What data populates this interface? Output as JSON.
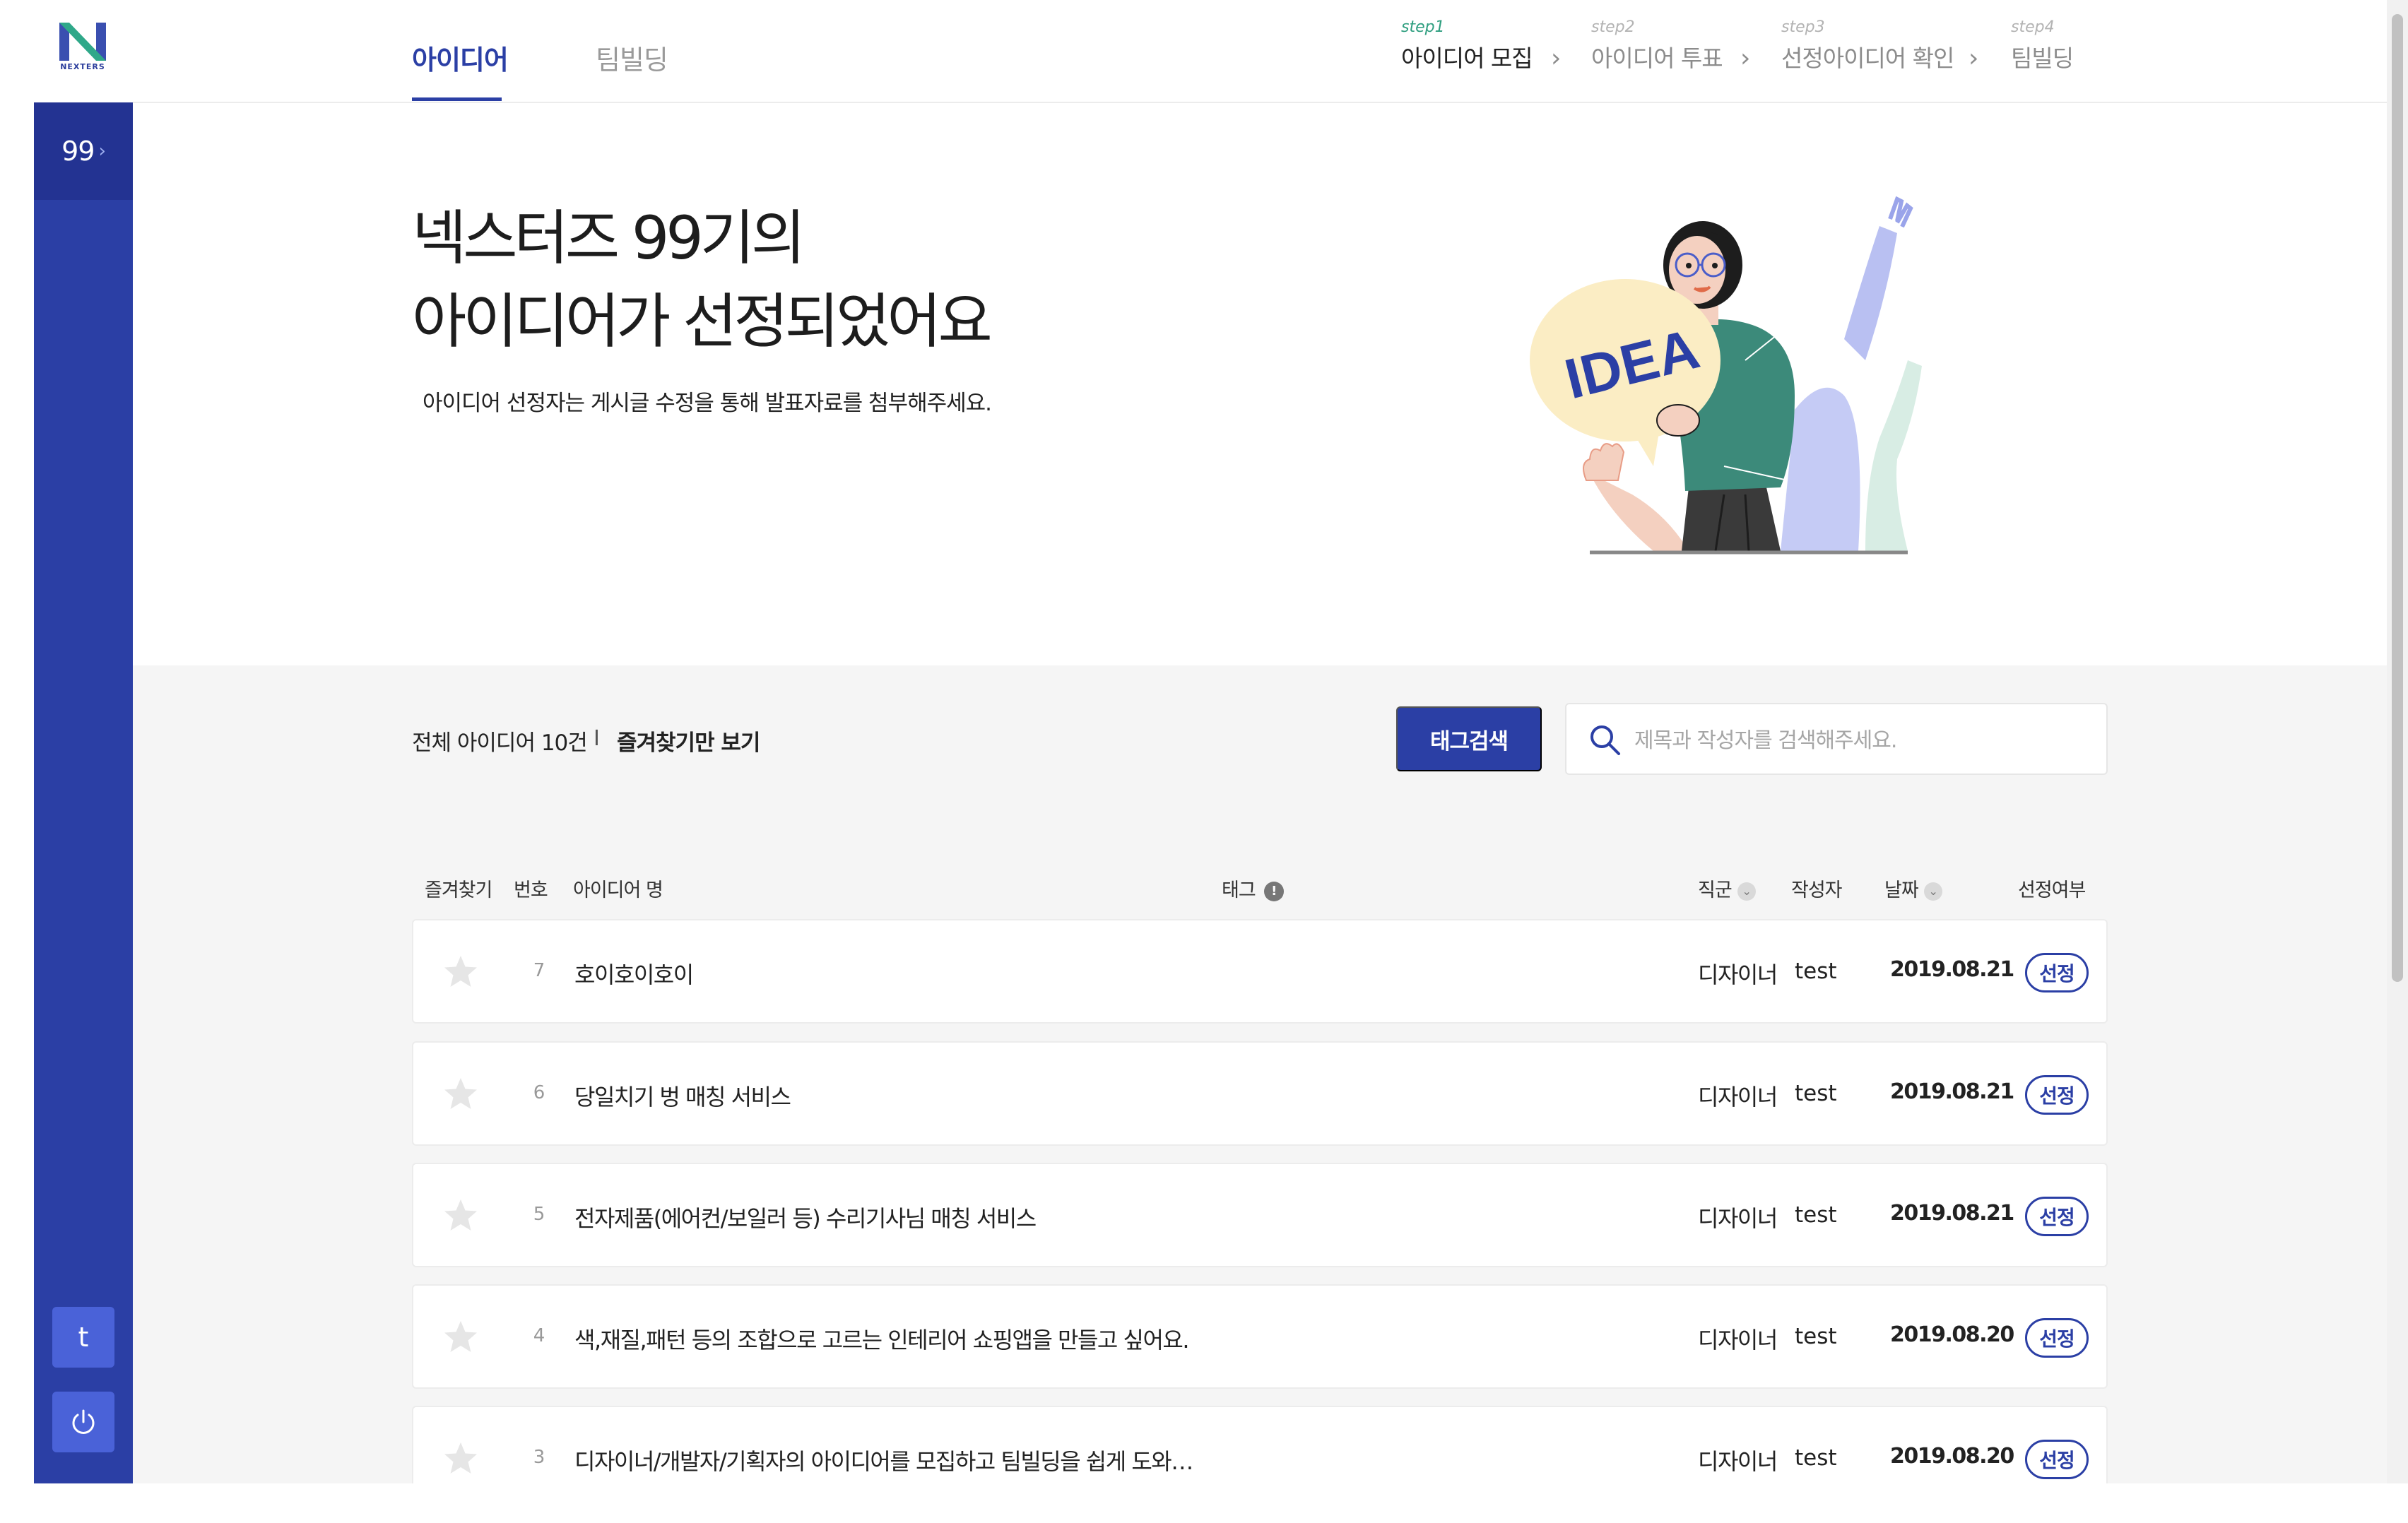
{
  "logo": {
    "text": "NEXTERS"
  },
  "sidebar": {
    "generation_label": "99",
    "generation_chevron": "›",
    "user_initial": "t",
    "icons": [
      "power-icon"
    ]
  },
  "tabs": [
    {
      "label": "아이디어",
      "active": true
    },
    {
      "label": "팀빌딩",
      "active": false
    }
  ],
  "steps": [
    {
      "step": "step1",
      "name": "아이디어 모집",
      "current": true
    },
    {
      "step": "step2",
      "name": "아이디어 투표",
      "current": false
    },
    {
      "step": "step3",
      "name": "선정아이디어 확인",
      "current": false
    },
    {
      "step": "step4",
      "name": "팀빌딩",
      "current": false
    }
  ],
  "hero": {
    "title_line1": "넥스터즈 99기의",
    "title_line2": "아이디어가 선정되었어요",
    "subtitle": "아이디어 선정자는 게시글 수정을 통해 발표자료를 첨부해주세요.",
    "illustration_text": "IDEA"
  },
  "list": {
    "total_label": "전체 아이디어 10건",
    "separator": "I",
    "favorites_only": "즐겨찾기만 보기",
    "tag_search_button": "태그검색",
    "search_placeholder": "제목과 작성자를 검색해주세요.",
    "search_value": ""
  },
  "table": {
    "headers": {
      "favorite": "즐겨찾기",
      "number": "번호",
      "idea_name": "아이디어 명",
      "tag": "태그",
      "role": "직군",
      "author": "작성자",
      "date": "날짜",
      "selected": "선정여부"
    },
    "rows": [
      {
        "number": "7",
        "title": "호이호이호이",
        "role": "디자이너",
        "author": "test",
        "date": "2019.08.21",
        "status": "선정"
      },
      {
        "number": "6",
        "title": "당일치기 벙 매칭 서비스",
        "role": "디자이너",
        "author": "test",
        "date": "2019.08.21",
        "status": "선정"
      },
      {
        "number": "5",
        "title": "전자제품(에어컨/보일러 등) 수리기사님 매칭 서비스",
        "role": "디자이너",
        "author": "test",
        "date": "2019.08.21",
        "status": "선정"
      },
      {
        "number": "4",
        "title": "색,재질,패턴 등의 조합으로 고르는 인테리어 쇼핑앱을 만들고 싶어요.",
        "role": "디자이너",
        "author": "test",
        "date": "2019.08.20",
        "status": "선정"
      },
      {
        "number": "3",
        "title": "디자이너/개발자/기획자의 아이디어를 모집하고 팀빌딩을 쉽게 도와…",
        "role": "디자이너",
        "author": "test",
        "date": "2019.08.20",
        "status": "선정"
      }
    ]
  },
  "colors": {
    "brand": "#2b3fa5",
    "sidebar_dark": "#233392",
    "step_active": "#2e9e7f",
    "section_bg": "#f5f5f5"
  }
}
